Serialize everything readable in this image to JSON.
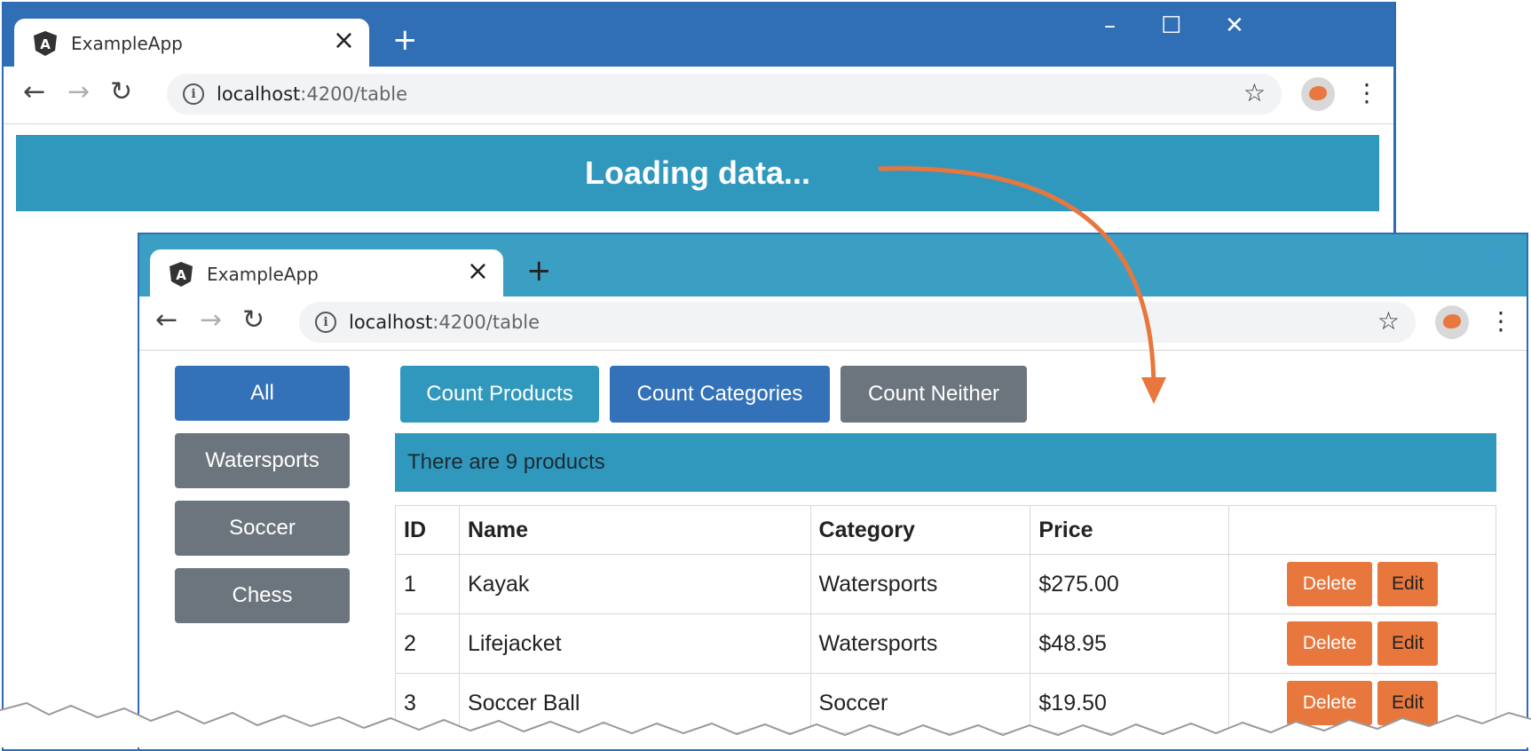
{
  "back_window": {
    "tab": {
      "title": "ExampleApp",
      "close": "×"
    },
    "new_tab": "+",
    "window_controls": {
      "minimize": "–",
      "maximize": "☐",
      "close": "✕"
    },
    "address": {
      "host": "localhost",
      "path": ":4200/table"
    },
    "banner": "Loading data..."
  },
  "front_window": {
    "tab": {
      "title": "ExampleApp",
      "close": "×"
    },
    "new_tab": "+",
    "window_controls": {
      "minimize": "–",
      "maximize": "☐",
      "close": "✕"
    },
    "address": {
      "host": "localhost",
      "path": ":4200/table"
    },
    "categories": [
      "All",
      "Watersports",
      "Soccer",
      "Chess"
    ],
    "count_buttons": {
      "products": "Count Products",
      "categories": "Count Categories",
      "neither": "Count Neither"
    },
    "alert": "There are 9 products",
    "table": {
      "headers": [
        "ID",
        "Name",
        "Category",
        "Price",
        ""
      ],
      "rows": [
        {
          "id": "1",
          "name": "Kayak",
          "category": "Watersports",
          "price": "$275.00"
        },
        {
          "id": "2",
          "name": "Lifejacket",
          "category": "Watersports",
          "price": "$48.95"
        },
        {
          "id": "3",
          "name": "Soccer Ball",
          "category": "Soccer",
          "price": "$19.50"
        }
      ],
      "delete_label": "Delete",
      "edit_label": "Edit"
    }
  },
  "icons": {
    "back": "←",
    "forward": "→",
    "reload": "↻",
    "info": "i",
    "star": "☆",
    "menu": "⋮"
  },
  "colors": {
    "back_titlebar": "#306fb5",
    "front_titlebar": "#3b9fc4",
    "primary": "#3372b8",
    "secondary": "#6c757d",
    "info": "#3198bd",
    "action": "#e8773e",
    "arrow": "#e8773e"
  }
}
